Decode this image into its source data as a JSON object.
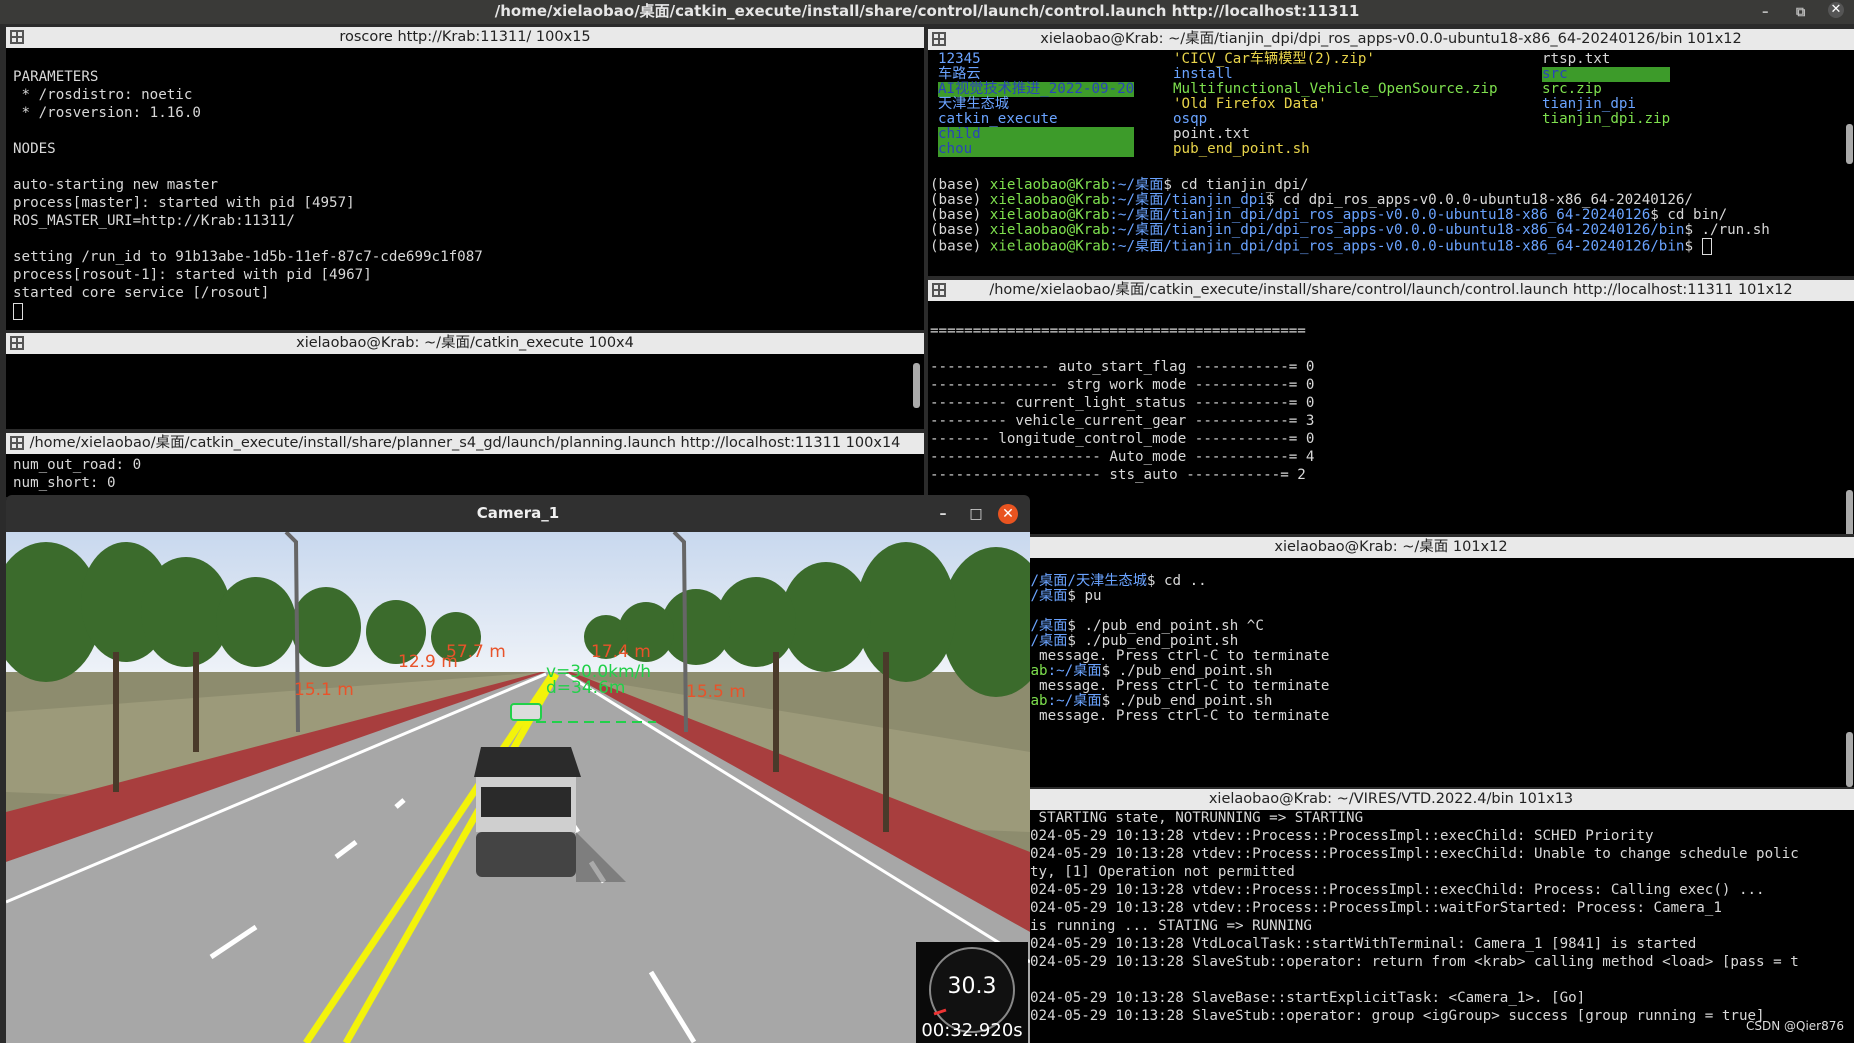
{
  "main_title": "/home/xielaobao/桌面/catkin_execute/install/share/control/launch/control.launch http://localhost:11311",
  "panes": {
    "roscore": {
      "title": "roscore http://Krab:11311/ 100x15",
      "lines": [
        "",
        "PARAMETERS",
        " * /rosdistro: noetic",
        " * /rosversion: 1.16.0",
        "",
        "NODES",
        "",
        "auto-starting new master",
        "process[master]: started with pid [4957]",
        "ROS_MASTER_URI=http://Krab:11311/",
        "",
        "setting /run_id to 91b13abe-1d5b-11ef-87c7-cde699c1f087",
        "process[rosout-1]: started with pid [4967]",
        "started core service [/rosout]"
      ]
    },
    "catkin": {
      "title": "xielaobao@Krab: ~/桌面/catkin_execute 100x4"
    },
    "planning": {
      "title": "/home/xielaobao/桌面/catkin_execute/install/share/planner_s4_gd/launch/planning.launch http://localhost:11311 100x14",
      "lines": [
        "num_out_road: 0",
        "num_short: 0"
      ]
    },
    "tianjin": {
      "title": "xielaobao@Krab: ~/桌面/tianjin_dpi/dpi_ros_apps-v0.0.0-ubuntu18-x86_64-20240126/bin 101x12",
      "ls_col1": [
        "12345",
        "车路云",
        "AI视觉技术推进_2022-09-20",
        "天津生态城",
        "catkin_execute",
        "child",
        "chou"
      ],
      "ls_col2": [
        "'CICV_Car车辆模型(2).zip'",
        "install",
        "Multifunctional_Vehicle_OpenSource.zip",
        "'Old Firefox Data'",
        "osqp",
        "point.txt",
        "pub_end_point.sh"
      ],
      "ls_col3": [
        "rtsp.txt",
        "src",
        "src.zip",
        "tianjin_dpi",
        "tianjin_dpi.zip"
      ],
      "prompts": [
        {
          "pre": "(base) ",
          "user": "xielaobao@Krab",
          "path": ":~/桌面",
          "cmd": "$ cd tianjin_dpi/"
        },
        {
          "pre": "(base) ",
          "user": "xielaobao@Krab",
          "path": ":~/桌面/tianjin_dpi",
          "cmd": "$ cd dpi_ros_apps-v0.0.0-ubuntu18-x86_64-20240126/"
        },
        {
          "pre": "(base) ",
          "user": "xielaobao@Krab",
          "path": ":~/桌面/tianjin_dpi/dpi_ros_apps-v0.0.0-ubuntu18-x86_64-20240126",
          "cmd": "$ cd bin/"
        },
        {
          "pre": "(base) ",
          "user": "xielaobao@Krab",
          "path": ":~/桌面/tianjin_dpi/dpi_ros_apps-v0.0.0-ubuntu18-x86_64-20240126/bin",
          "cmd": "$ ./run.sh"
        },
        {
          "pre": "(base) ",
          "user": "xielaobao@Krab",
          "path": ":~/桌面/tianjin_dpi/dpi_ros_apps-v0.0.0-ubuntu18-x86_64-20240126/bin",
          "cmd": "$ "
        }
      ]
    },
    "control": {
      "title": "/home/xielaobao/桌面/catkin_execute/install/share/control/launch/control.launch http://localhost:11311 101x12",
      "lines": [
        "",
        "============================================",
        "",
        "-------------- auto_start_flag -----------= 0",
        "--------------- strg work mode -----------= 0",
        "--------- current_light_status -----------= 0",
        "--------- vehicle_current_gear -----------= 3",
        "------- longitude_control_mode -----------= 0",
        "-------------------- Auto_mode -----------= 4",
        "-------------------- sts_auto -----------= 2"
      ]
    },
    "desktop": {
      "title": "xielaobao@Krab: ~/桌面 101x12",
      "lines": [
        {
          "a": "",
          "b": "",
          "c": " pushd"
        },
        {
          "a": "aobao@Krab",
          "b": ":~/桌面/天津生态城",
          "c": "$ cd .."
        },
        {
          "a": "aobao@Krab",
          "b": ":~/桌面",
          "c": "$ pu"
        },
        {
          "a": "",
          "b": "",
          "c": " pushd"
        },
        {
          "a": "aobao@Krab",
          "b": ":~/桌面",
          "c": "$ ./pub_end_point.sh ^C"
        },
        {
          "a": "aobao@Krab",
          "b": ":~/桌面",
          "c": "$ ./pub_end_point.sh"
        },
        {
          "a": "",
          "b": "",
          "c": "and latching message. Press ctrl-C to terminate"
        },
        {
          "a": "xielaobao@Krab",
          "b": ":~/桌面",
          "c": "$ ./pub_end_point.sh"
        },
        {
          "a": "",
          "b": "",
          "c": "and latching message. Press ctrl-C to terminate"
        },
        {
          "a": "xielaobao@Krab",
          "b": ":~/桌面",
          "c": "$ ./pub_end_point.sh"
        },
        {
          "a": "",
          "b": "",
          "c": "and latching message. Press ctrl-C to terminate"
        }
      ]
    },
    "vtd": {
      "title": "xielaobao@Krab: ~/VIRES/VTD.2022.4/bin 101x13",
      "lines": [
        " STARTING state, NOTRUNNING => STARTING",
        "024-05-29 10:13:28 vtdev::Process::ProcessImpl::execChild: SCHED Priority",
        "024-05-29 10:13:28 vtdev::Process::ProcessImpl::execChild: Unable to change schedule polic",
        "ty, [1] Operation not permitted",
        "024-05-29 10:13:28 vtdev::Process::ProcessImpl::execChild: Process: Calling exec() ...",
        "024-05-29 10:13:28 vtdev::Process::ProcessImpl::waitForStarted: Process: Camera_1",
        "is running ... STATING => RUNNING",
        "024-05-29 10:13:28 VtdLocalTask::startWithTerminal: Camera_1 [9841] is started",
        "024-05-29 10:13:28 SlaveStub::operator: return from <krab> calling method <load> [pass = t",
        "",
        "024-05-29 10:13:28 SlaveBase::startExplicitTask: <Camera_1>. [Go]",
        "024-05-29 10:13:28 SlaveStub::operator: group <igGroup> success [group running = true]"
      ]
    }
  },
  "camera": {
    "title": "Camera_1",
    "labels": {
      "red1": "15.1 m",
      "red2": "12.9 m",
      "red3": "57.7 m",
      "red4": "17.4 m",
      "red5": "15.5 m",
      "green_v": "v=30.0km/h",
      "green_d": "d=34.6m"
    },
    "speed": "30.3",
    "time": "00:32.920s"
  },
  "watermark": "CSDN @Qier876",
  "colors": {
    "accent_close": "#e95420",
    "prompt_green": "#7ee04e",
    "path_blue": "#6aa3ff"
  }
}
